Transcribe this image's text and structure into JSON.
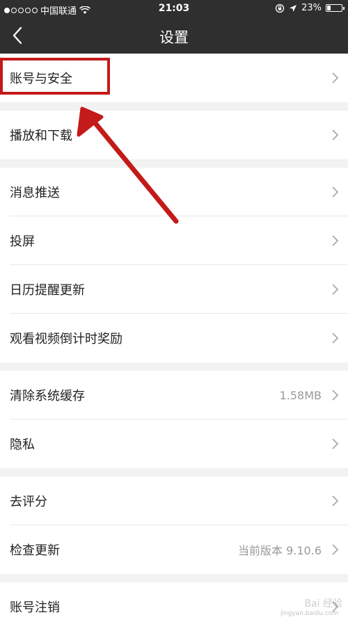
{
  "status_bar": {
    "carrier": "中国联通",
    "time": "21:03",
    "battery": "23%",
    "battery_level": 0.23,
    "signal_dots_filled": 1,
    "signal_dots_total": 5,
    "icons": [
      "wifi-icon",
      "orientation-lock-icon",
      "location-icon",
      "battery-icon"
    ]
  },
  "nav": {
    "title": "设置",
    "back_icon": "chevron-left-icon"
  },
  "groups": [
    {
      "items": [
        {
          "label": "账号与安全",
          "value": ""
        }
      ]
    },
    {
      "items": [
        {
          "label": "播放和下载",
          "value": ""
        }
      ]
    },
    {
      "items": [
        {
          "label": "消息推送",
          "value": ""
        },
        {
          "label": "投屏",
          "value": ""
        },
        {
          "label": "日历提醒更新",
          "value": ""
        },
        {
          "label": "观看视频倒计时奖励",
          "value": ""
        }
      ]
    },
    {
      "items": [
        {
          "label": "清除系统缓存",
          "value": "1.58MB"
        },
        {
          "label": "隐私",
          "value": ""
        }
      ]
    },
    {
      "items": [
        {
          "label": "去评分",
          "value": ""
        },
        {
          "label": "检查更新",
          "value": "当前版本 9.10.6"
        }
      ]
    },
    {
      "items": [
        {
          "label": "账号注销",
          "value": ""
        }
      ]
    }
  ],
  "annotation": {
    "highlight_color": "#c41a1a",
    "highlight_target": "账号与安全"
  },
  "watermark": {
    "text": "Bai 经验",
    "url_text": "jingyan.baidu.com"
  },
  "colors": {
    "nav_bg": "#2f2f2f",
    "page_bg": "#f2f2f2",
    "row_bg": "#ffffff",
    "value_text": "#999999"
  }
}
